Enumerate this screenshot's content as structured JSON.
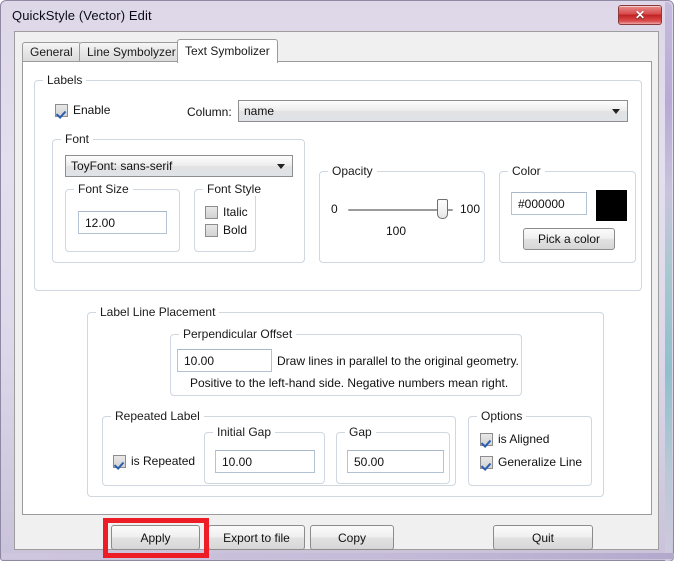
{
  "window": {
    "title": "QuickStyle (Vector) Edit",
    "close_glyph": "✕"
  },
  "tabs": [
    {
      "label": "General",
      "active": false
    },
    {
      "label": "Line Symbolyzer",
      "active": false
    },
    {
      "label": "Text Symbolizer",
      "active": true
    }
  ],
  "labels_group": {
    "title": "Labels",
    "enable": {
      "label": "Enable",
      "checked": true
    },
    "column": {
      "label": "Column:",
      "value": "name"
    }
  },
  "font_group": {
    "title": "Font",
    "family": {
      "value": "ToyFont: sans-serif"
    },
    "size_group": {
      "title": "Font Size",
      "value": "12.00"
    },
    "style_group": {
      "title": "Font Style",
      "italic": {
        "label": "Italic",
        "checked": false
      },
      "bold": {
        "label": "Bold",
        "checked": false
      }
    }
  },
  "opacity_group": {
    "title": "Opacity",
    "min_label": "0",
    "max_label": "100",
    "value_label": "100",
    "value": 100
  },
  "color_group": {
    "title": "Color",
    "hex_value": "#000000",
    "swatch_color": "#000000",
    "pick_button": "Pick a color"
  },
  "placement_group": {
    "title": "Label Line Placement",
    "offset_group": {
      "title": "Perpendicular Offset",
      "value": "10.00",
      "hint_line1": "Draw lines in parallel to the original geometry.",
      "hint_line2": "Positive to the left-hand side. Negative numbers mean right."
    },
    "repeated_group": {
      "title": "Repeated Label",
      "is_repeated": {
        "label": "is Repeated",
        "checked": true
      },
      "initial_gap": {
        "title": "Initial Gap",
        "value": "10.00"
      },
      "gap": {
        "title": "Gap",
        "value": "50.00"
      }
    },
    "options_group": {
      "title": "Options",
      "is_aligned": {
        "label": "is Aligned",
        "checked": true
      },
      "generalize_line": {
        "label": "Generalize Line",
        "checked": true
      }
    }
  },
  "footer": {
    "apply": "Apply",
    "export": "Export to file",
    "copy": "Copy",
    "quit": "Quit"
  },
  "colors": {
    "highlight": "#ee1c25",
    "accent_check": "#2a5db0"
  }
}
